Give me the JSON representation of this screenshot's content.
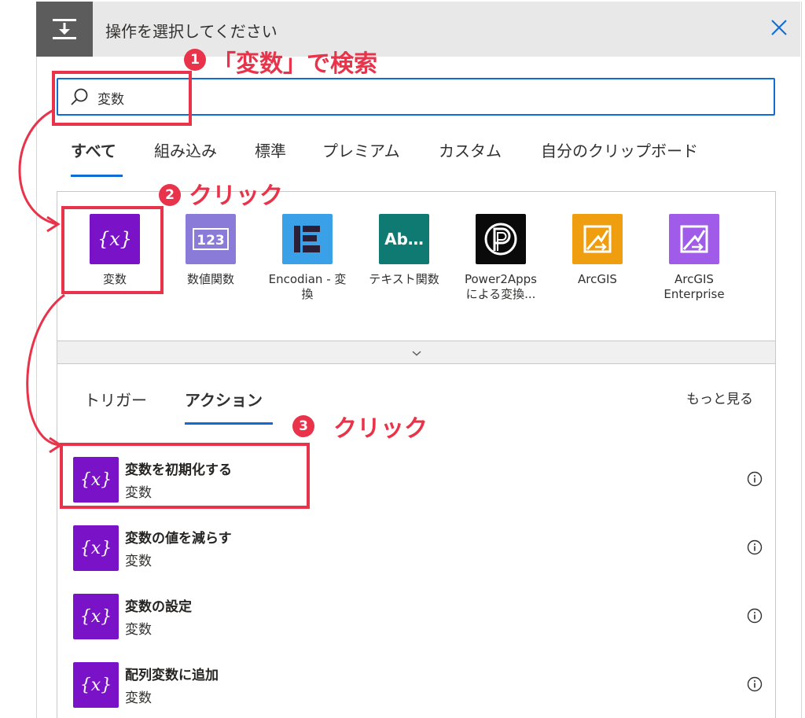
{
  "header": {
    "title": "操作を選択してください"
  },
  "search": {
    "value": "変数",
    "placeholder": ""
  },
  "tabs": [
    {
      "label": "すべて",
      "active": true
    },
    {
      "label": "組み込み"
    },
    {
      "label": "標準"
    },
    {
      "label": "プレミアム"
    },
    {
      "label": "カスタム"
    },
    {
      "label": "自分のクリップボード"
    }
  ],
  "connectors": [
    {
      "label": "変数",
      "color": "#7a12c8",
      "icon": "variable-braces-icon"
    },
    {
      "label": "数値関数",
      "color": "#8a7bd8",
      "icon": "number-123-icon"
    },
    {
      "label": "Encodian - 変換",
      "color": "#3aa0e8",
      "icon": "encodian-icon"
    },
    {
      "label": "テキスト関数",
      "color": "#0e7a72",
      "icon": "text-ab-icon",
      "icon_text": "Ab…"
    },
    {
      "label": "Power2Apps による変換...",
      "color": "#0a0a0a",
      "icon": "power2apps-icon"
    },
    {
      "label": "ArcGIS",
      "color": "#ef9e10",
      "icon": "arcgis-icon"
    },
    {
      "label": "ArcGIS Enterprise",
      "color": "#a05ce8",
      "icon": "arcgis-enterprise-icon"
    }
  ],
  "subtabs": [
    {
      "label": "トリガー"
    },
    {
      "label": "アクション",
      "active": true
    }
  ],
  "see_more": "もっと見る",
  "actions": [
    {
      "title": "変数を初期化する",
      "subtitle": "変数"
    },
    {
      "title": "変数の値を減らす",
      "subtitle": "変数"
    },
    {
      "title": "変数の設定",
      "subtitle": "変数"
    },
    {
      "title": "配列変数に追加",
      "subtitle": "変数"
    }
  ],
  "annotations": {
    "step1_label": "「変数」で検索",
    "step2_label": "クリック",
    "step3_label": "クリック",
    "badge1": "1",
    "badge2": "2",
    "badge3": "3"
  },
  "colors": {
    "accent": "#0f6cd6",
    "annotation": "#e8334a",
    "variable_purple": "#7a12c8"
  }
}
